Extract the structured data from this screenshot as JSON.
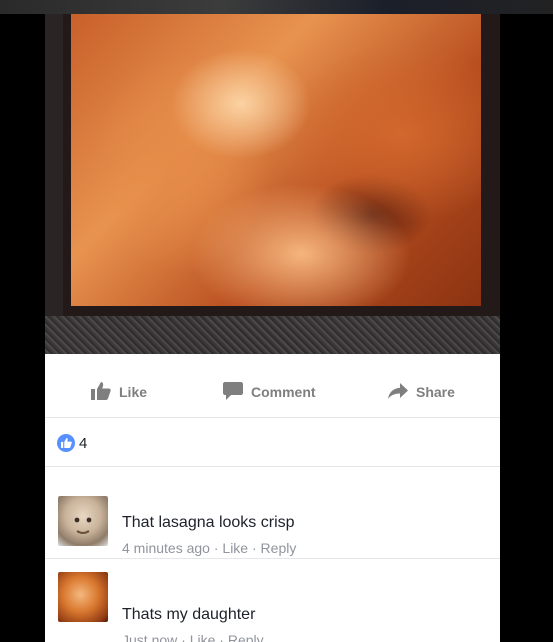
{
  "post": {
    "photo_icon": "ultrasound-photo",
    "actions": {
      "like": {
        "label": "Like",
        "icon": "thumbs-up-icon"
      },
      "comment": {
        "label": "Comment",
        "icon": "comment-icon"
      },
      "share": {
        "label": "Share",
        "icon": "share-arrow-icon"
      }
    },
    "reactions": {
      "icon": "like-badge-icon",
      "count": "4",
      "color": "#5890ff"
    }
  },
  "comments": [
    {
      "text": "That lasagna looks crisp",
      "time": "4 minutes ago",
      "like": "Like",
      "reply": "Reply",
      "separator": "·"
    },
    {
      "text": "Thats my daughter",
      "time": "Just now",
      "like": "Like",
      "reply": "Reply",
      "separator": "·"
    }
  ],
  "colors": {
    "meta": "#90949c",
    "action": "#7f7f7f",
    "text": "#1d2129"
  }
}
